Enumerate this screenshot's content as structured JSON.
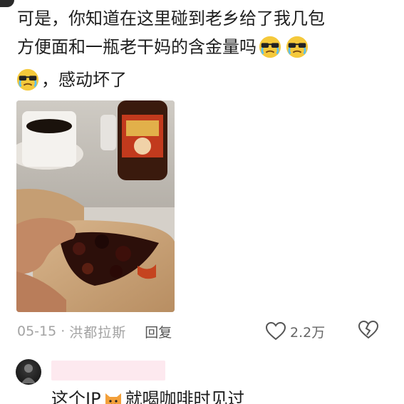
{
  "post": {
    "line1": "可是，你知道在这里碰到老乡给了我几包",
    "line2": "方便面和一瓶老干妈的含金量吗",
    "line3": "，感动坏了"
  },
  "meta": {
    "date": "05-15",
    "separator": "·",
    "location": "洪都拉斯",
    "reply_label": "回复",
    "like_count": "2.2万"
  },
  "icons": {
    "emoji": "crying-sunglasses-emoji",
    "like": "heart-outline-icon",
    "dislike": "broken-heart-icon",
    "cat": "cat-face-emoji"
  },
  "reply": {
    "text_before": "这个IP",
    "text_after": "就喝咖啡时见过"
  },
  "colors": {
    "text": "#1e1e1e",
    "meta": "#a3a3a3",
    "name_highlight": "#fde9ef"
  }
}
